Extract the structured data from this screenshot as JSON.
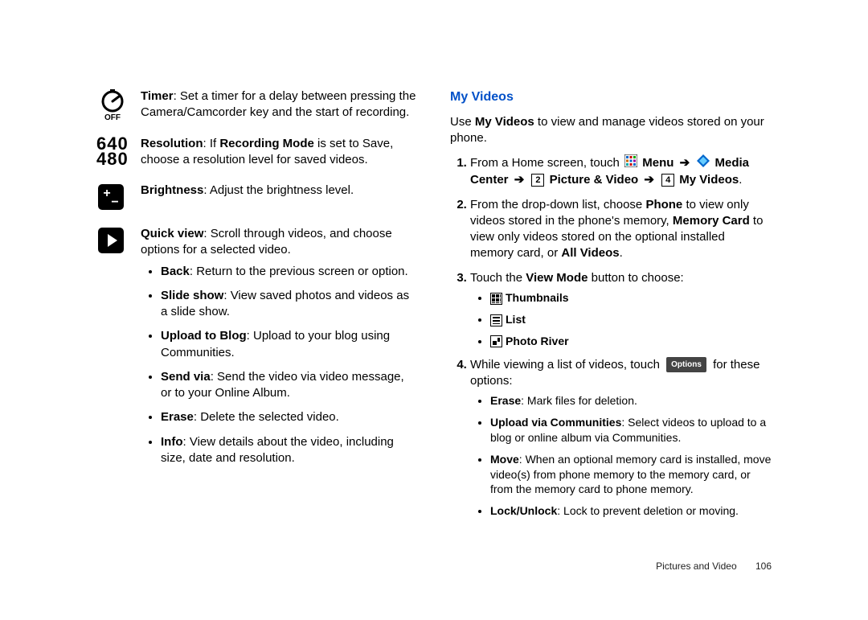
{
  "left": {
    "timer": {
      "label": "Timer",
      "text": ": Set a timer for a delay between pressing the Camera/Camcorder key and the start of recording."
    },
    "res_big": "640",
    "res_small": "480",
    "resolution": {
      "label": "Resolution",
      "mid1": ": If ",
      "mid_bold": "Recording Mode",
      "mid2": " is set to Save, choose a resolution level for saved videos."
    },
    "brightness": {
      "label": "Brightness",
      "text": ": Adjust the brightness level."
    },
    "quickview": {
      "label": "Quick view",
      "text": ": Scroll through videos, and choose options for a selected video."
    },
    "items": [
      {
        "b": "Back",
        "t": ": Return to the previous screen or option."
      },
      {
        "b": "Slide show",
        "t": ": View saved photos and videos as a slide show."
      },
      {
        "b": "Upload to Blog",
        "t": ": Upload to your blog using Communities."
      },
      {
        "b": "Send via",
        "t": ": Send the video via video message, or to your Online Album."
      },
      {
        "b": "Erase",
        "t": ": Delete the selected video."
      },
      {
        "b": "Info",
        "t": ": View details about the video, including size, date and resolution."
      }
    ]
  },
  "right": {
    "heading": "My Videos",
    "intro_pre": "Use ",
    "intro_bold": "My Videos",
    "intro_post": " to view and manage videos stored on your phone.",
    "step1": {
      "pre": "From a Home screen, touch ",
      "menu": "Menu",
      "mc": "Media Center",
      "pv": "Picture & Video",
      "mv": "My Videos",
      "badge2": "2",
      "badge4": "4"
    },
    "step2": {
      "pre": "From the drop-down list, choose ",
      "b1": "Phone",
      "t1": " to view only videos stored in the phone's memory, ",
      "b2": "Memory Card",
      "t2": " to view only videos stored on the optional installed memory card, or ",
      "b3": "All Videos",
      "t3": "."
    },
    "step3": {
      "pre": "Touch the ",
      "b": "View Mode",
      "post": " button to choose:",
      "opts": [
        "Thumbnails",
        "List",
        "Photo River"
      ]
    },
    "step4": {
      "pre": "While viewing a list of videos, touch ",
      "badge": "Options",
      "post": " for these options:",
      "items": [
        {
          "b": "Erase",
          "t": ": Mark files for deletion."
        },
        {
          "b": "Upload via Communities",
          "t": ": Select videos to upload to a blog or online album via Communities."
        },
        {
          "b": "Move",
          "t": ": When an optional memory card is installed, move video(s) from phone memory to the memory card, or from the memory card to phone memory."
        },
        {
          "b": "Lock/Unlock",
          "t": ": Lock to prevent deletion or moving."
        }
      ]
    }
  },
  "footer": {
    "section": "Pictures and Video",
    "page": "106"
  }
}
